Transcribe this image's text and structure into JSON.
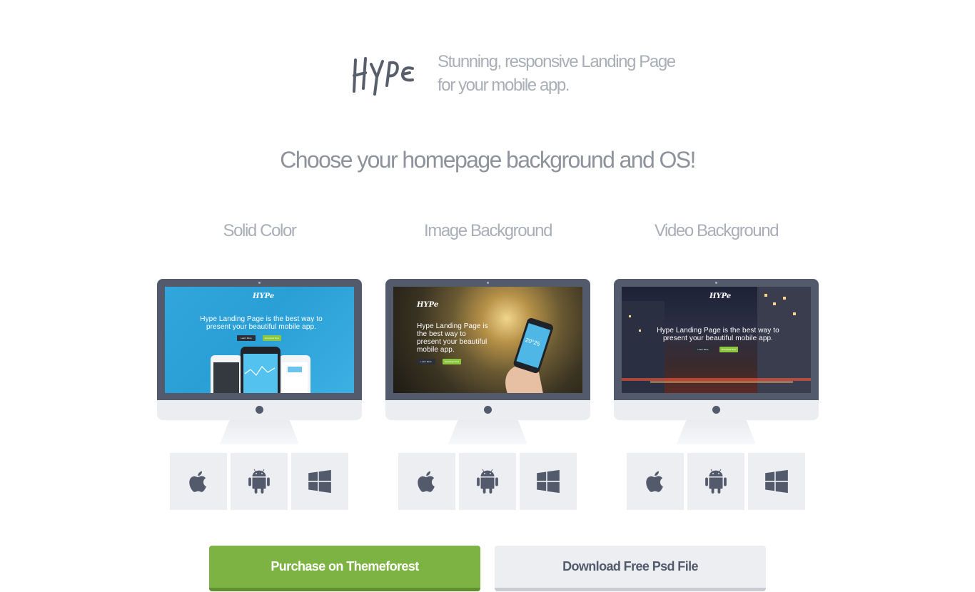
{
  "header": {
    "logo_text": "Hype",
    "tagline_line1": "Stunning, responsive Landing Page",
    "tagline_line2": "for your mobile app."
  },
  "headline": "Choose your homepage background and OS!",
  "options": [
    {
      "title": "Solid Color",
      "screen": {
        "logo": "HYPe",
        "text": "Hype Landing Page is the best way to present your beautiful mobile app.",
        "btn_learn": "Learn More",
        "btn_download": "Download Now"
      },
      "os": [
        "apple-icon",
        "android-icon",
        "windows-icon"
      ]
    },
    {
      "title": "Image Background",
      "screen": {
        "logo": "HYPe",
        "text": "Hype Landing Page is the best way to present your beautiful mobile app.",
        "btn_learn": "Learn More",
        "btn_download": "Download Now",
        "phone_temp": "20°25"
      },
      "os": [
        "apple-icon",
        "android-icon",
        "windows-icon"
      ]
    },
    {
      "title": "Video Background",
      "screen": {
        "logo": "HYPe",
        "text": "Hype Landing Page is the best way to present your beautiful mobile app.",
        "btn_learn": "Learn More",
        "btn_download": "Download Now"
      },
      "os": [
        "apple-icon",
        "android-icon",
        "windows-icon"
      ]
    }
  ],
  "buttons": {
    "purchase": "Purchase on Themeforest",
    "download": "Download Free Psd File"
  },
  "colors": {
    "accent_green": "#7cb342",
    "dark_slate": "#525a6b",
    "tile_bg": "#eceef2",
    "text_gray": "#a9aeb7"
  }
}
